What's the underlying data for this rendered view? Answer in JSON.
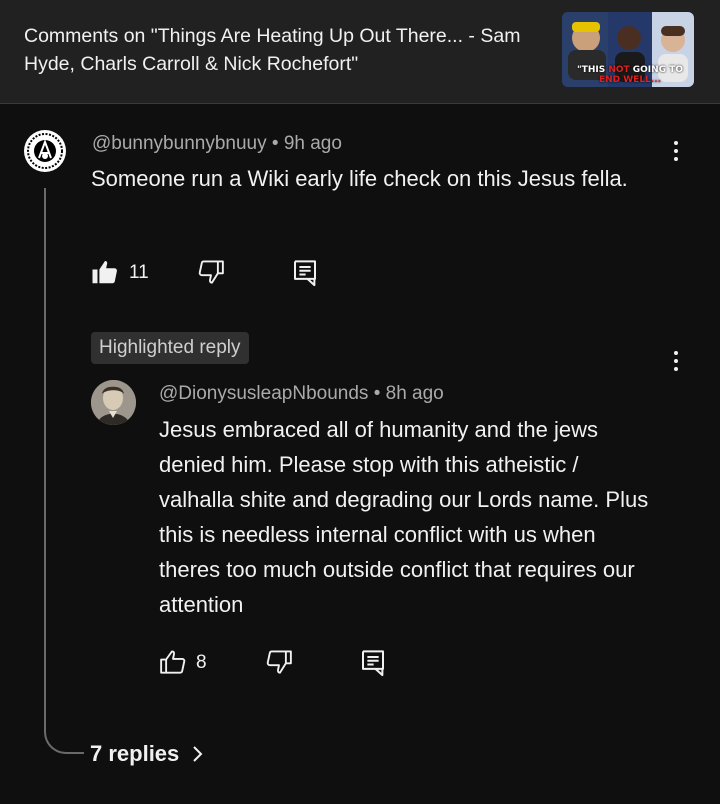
{
  "header": {
    "title": "Comments on \"Things Are Heating Up Out There... - Sam Hyde, Charls Carroll & Nick Rochefort\"",
    "thumbnail_caption_1": "\"THIS ",
    "thumbnail_caption_not": "NOT",
    "thumbnail_caption_2": " GOING TO",
    "thumbnail_caption_3": "END WELL..."
  },
  "comment": {
    "author": "@bunnybunnybnuuy",
    "time": "9h ago",
    "text": "Someone run a Wiki early life check on this Jesus fella.",
    "likes": "11",
    "avatar_icon": "anarchy-emblem-icon"
  },
  "reply": {
    "badge": "Highlighted reply",
    "author": "@DionysusleapNbounds",
    "time": "8h ago",
    "text": "Jesus embraced all of humanity and the jews denied him. Please stop with this atheistic / valhalla shite and degrading our Lords name. Plus this is needless internal conflict with us when theres too much outside conflict that requires our attention",
    "likes": "8",
    "avatar_icon": "portrait-avatar-icon"
  },
  "replies_link": {
    "label": "7 replies"
  },
  "separator": "•",
  "colors": {
    "background": "#0f0f0f",
    "header": "#212121",
    "text": "#f1f1f1",
    "secondary_text": "#aaaaaa",
    "thumb_red": "#e02020"
  }
}
